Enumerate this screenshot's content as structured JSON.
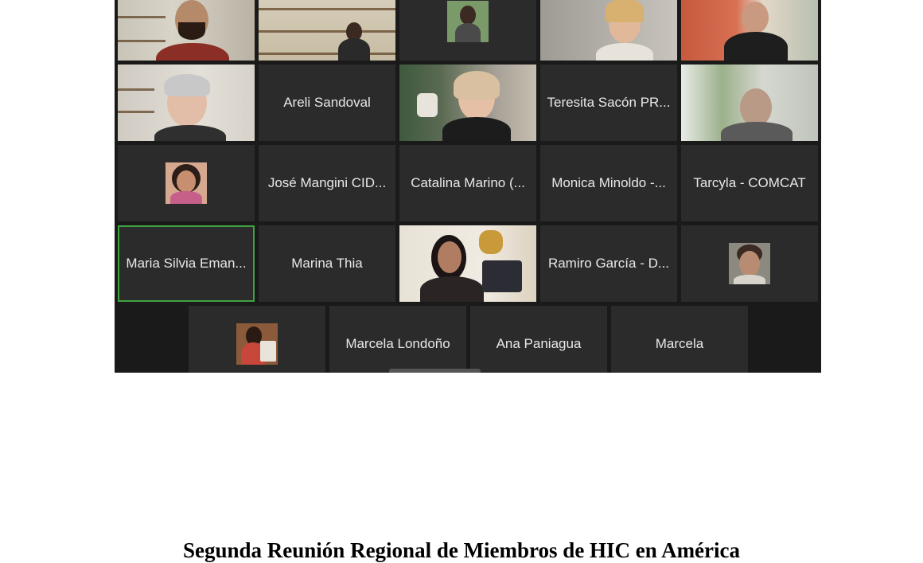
{
  "meeting": {
    "participants": [
      {
        "id": "p1",
        "label": ""
      },
      {
        "id": "p2",
        "label": ""
      },
      {
        "id": "p3",
        "label": ""
      },
      {
        "id": "p4",
        "label": ""
      },
      {
        "id": "p5",
        "label": ""
      },
      {
        "id": "p6",
        "label": ""
      },
      {
        "id": "p7",
        "label": "Areli Sandoval"
      },
      {
        "id": "p8",
        "label": ""
      },
      {
        "id": "p9",
        "label": "Teresita Sacón PR..."
      },
      {
        "id": "p10",
        "label": ""
      },
      {
        "id": "p11",
        "label": ""
      },
      {
        "id": "p12",
        "label": "José Mangini CID..."
      },
      {
        "id": "p13",
        "label": "Catalina Marino (..."
      },
      {
        "id": "p14",
        "label": "Monica Minoldo -..."
      },
      {
        "id": "p15",
        "label": "Tarcyla - COMCAT"
      },
      {
        "id": "p16",
        "label": "Maria Silvia Eman..."
      },
      {
        "id": "p17",
        "label": "Marina Thia"
      },
      {
        "id": "p18",
        "label": ""
      },
      {
        "id": "p19",
        "label": "Ramiro García - D..."
      },
      {
        "id": "p20",
        "label": ""
      },
      {
        "id": "p21",
        "label": ""
      },
      {
        "id": "p22",
        "label": "Marcela Londoño"
      },
      {
        "id": "p23",
        "label": "Ana Paniagua"
      },
      {
        "id": "p24",
        "label": "Marcela"
      }
    ],
    "active_speaker_border": "#3fa43f"
  },
  "document": {
    "title": "Segunda Reunión Regional de Miembros de HIC en América"
  }
}
